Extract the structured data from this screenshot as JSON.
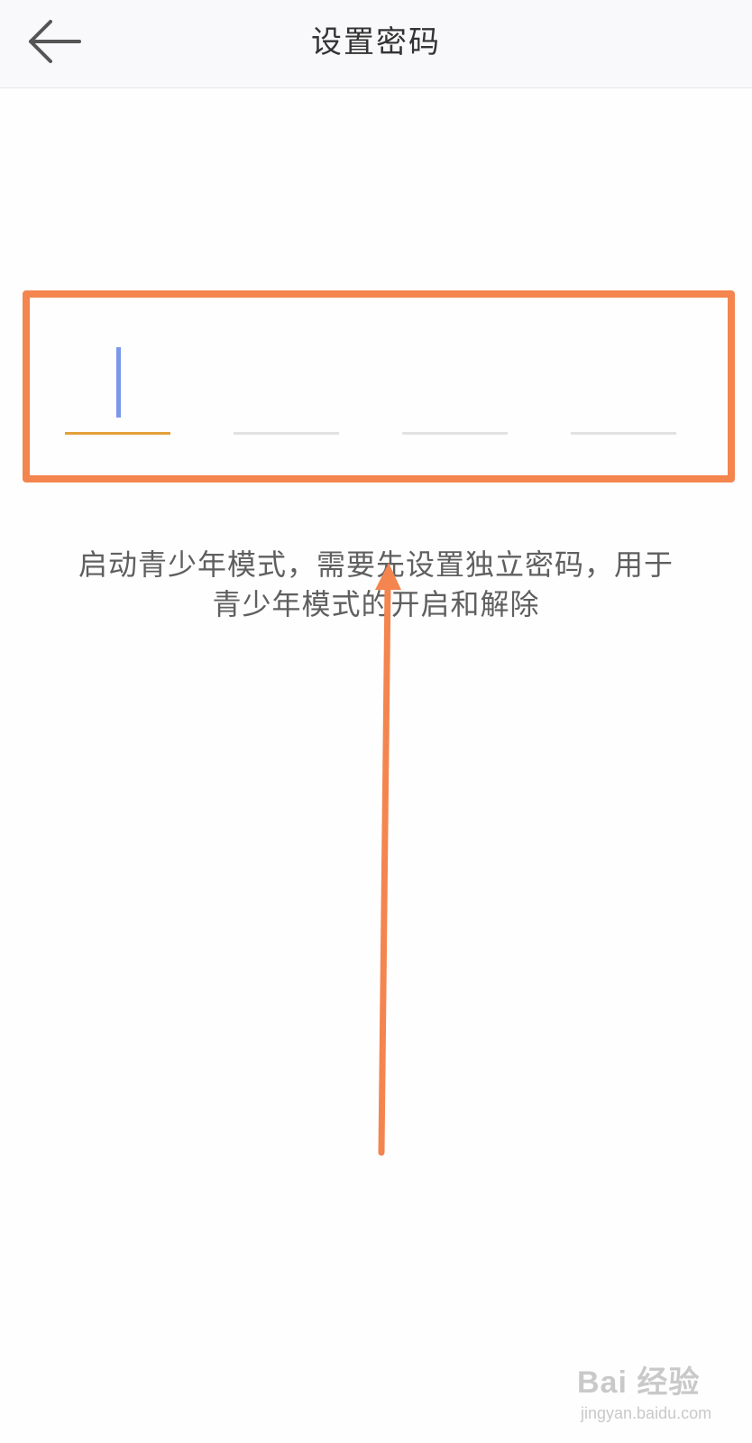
{
  "header": {
    "title": "设置密码",
    "back_icon": "arrow-left-icon"
  },
  "pin": {
    "length": 4,
    "entered": [
      "",
      "",
      "",
      ""
    ],
    "active_index": 0
  },
  "description": {
    "line1": "启动青少年模式，需要先设置独立密码，用于",
    "line2": "青少年模式的开启和解除"
  },
  "annotation": {
    "box_color": "#f4854f",
    "arrow_color": "#f4854f"
  },
  "colors": {
    "active_underline": "#e3a03a",
    "inactive_underline": "#e2e2e2",
    "cursor": "#7b97ea"
  },
  "watermark": {
    "logo": "Bai 经验",
    "url": "jingyan.baidu.com"
  }
}
